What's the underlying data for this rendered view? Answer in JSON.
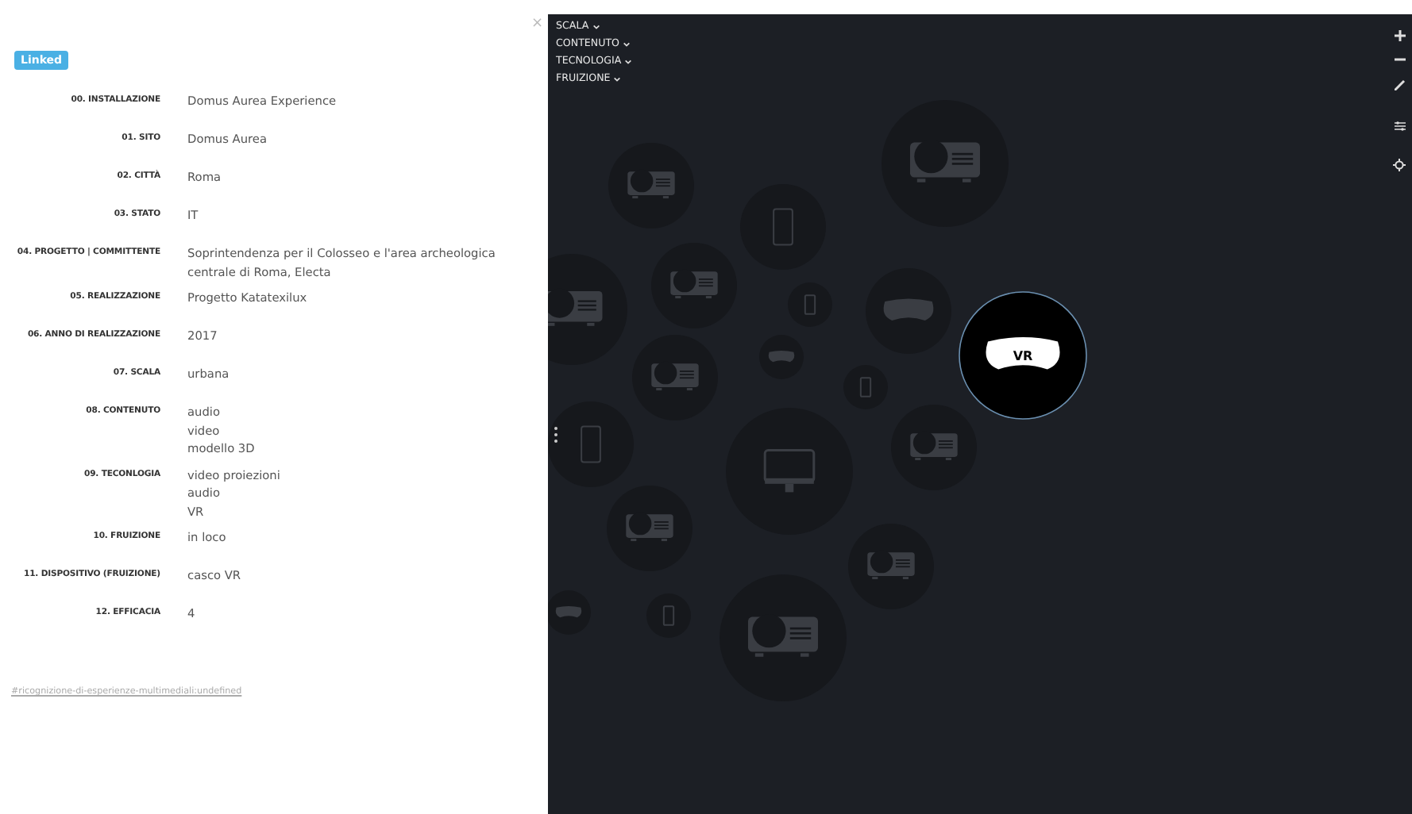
{
  "detail_panel": {
    "badge": "Linked",
    "close": "×",
    "fields": [
      {
        "label": "00. INSTALLAZIONE",
        "values": [
          "Domus Aurea Experience"
        ]
      },
      {
        "label": "01. SITO",
        "values": [
          "Domus Aurea"
        ]
      },
      {
        "label": "02. CITTÀ",
        "values": [
          "Roma"
        ]
      },
      {
        "label": "03. STATO",
        "values": [
          "IT"
        ]
      },
      {
        "label": "04. PROGETTO | COMMITTENTE",
        "values": [
          "Soprintendenza per il Colosseo e l'area archeologica centrale di Roma, Electa"
        ]
      },
      {
        "label": "05. REALIZZAZIONE",
        "values": [
          "Progetto Katatexilux"
        ]
      },
      {
        "label": "06. ANNO DI REALIZZAZIONE",
        "values": [
          "2017"
        ]
      },
      {
        "label": "07. SCALA",
        "values": [
          "urbana"
        ]
      },
      {
        "label": "08. CONTENUTO",
        "values": [
          "audio",
          "video",
          "modello 3D"
        ]
      },
      {
        "label": "09. TECONLOGIA",
        "values": [
          "video proiezioni",
          "audio",
          "VR"
        ]
      },
      {
        "label": "10. FRUIZIONE",
        "values": [
          "in loco"
        ]
      },
      {
        "label": "11. DISPOSITIVO (FRUIZIONE)",
        "values": [
          "casco VR"
        ]
      },
      {
        "label": "12. EFFICACIA",
        "values": [
          "4"
        ]
      }
    ],
    "link": "#ricognizione-di-esperienze-multimediali:undefined"
  },
  "filters": [
    {
      "label": "SCALA"
    },
    {
      "label": "CONTENUTO"
    },
    {
      "label": "TECNOLOGIA"
    },
    {
      "label": "FRUIZIONE"
    }
  ],
  "nodes": [
    {
      "kind": "projector",
      "selected": false
    },
    {
      "kind": "projector",
      "selected": false
    },
    {
      "kind": "phone",
      "selected": false
    },
    {
      "kind": "projector",
      "selected": false
    },
    {
      "kind": "projector",
      "selected": false
    },
    {
      "kind": "phone",
      "selected": false
    },
    {
      "kind": "headset",
      "selected": false
    },
    {
      "kind": "headset",
      "selected": false
    },
    {
      "kind": "headset",
      "selected": true,
      "label": "VR"
    },
    {
      "kind": "projector",
      "selected": false
    },
    {
      "kind": "phone",
      "selected": false
    },
    {
      "kind": "phone",
      "selected": false
    },
    {
      "kind": "monitor",
      "selected": false
    },
    {
      "kind": "projector",
      "selected": false
    },
    {
      "kind": "projector",
      "selected": false
    },
    {
      "kind": "projector",
      "selected": false
    },
    {
      "kind": "headset",
      "selected": false
    },
    {
      "kind": "phone",
      "selected": false
    },
    {
      "kind": "projector",
      "selected": false
    }
  ]
}
